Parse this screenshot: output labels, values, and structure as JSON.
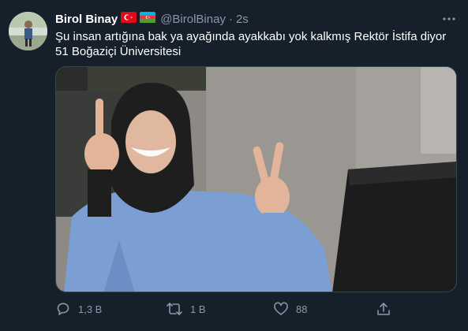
{
  "tweet": {
    "author_name": "Birol Binay",
    "author_handle": "@BirolBinay",
    "separator": "·",
    "time": "2s",
    "text_line1": "Şu insan artığına bak ya ayağında ayakkabı yok kalkmış Rektör İstifa diyor",
    "text_line2": "51 Boğaziçi Üniversitesi",
    "flags": [
      "turkey-flag-icon",
      "azerbaijan-flag-icon"
    ]
  },
  "actions": {
    "reply_count": "1,3 B",
    "retweet_count": "1 B",
    "like_count": "88",
    "reply_icon": "reply-icon",
    "retweet_icon": "retweet-icon",
    "like_icon": "heart-icon",
    "share_icon": "share-icon"
  },
  "colors": {
    "background": "#15202b",
    "secondary_text": "#8899a6",
    "border": "#38444d"
  }
}
